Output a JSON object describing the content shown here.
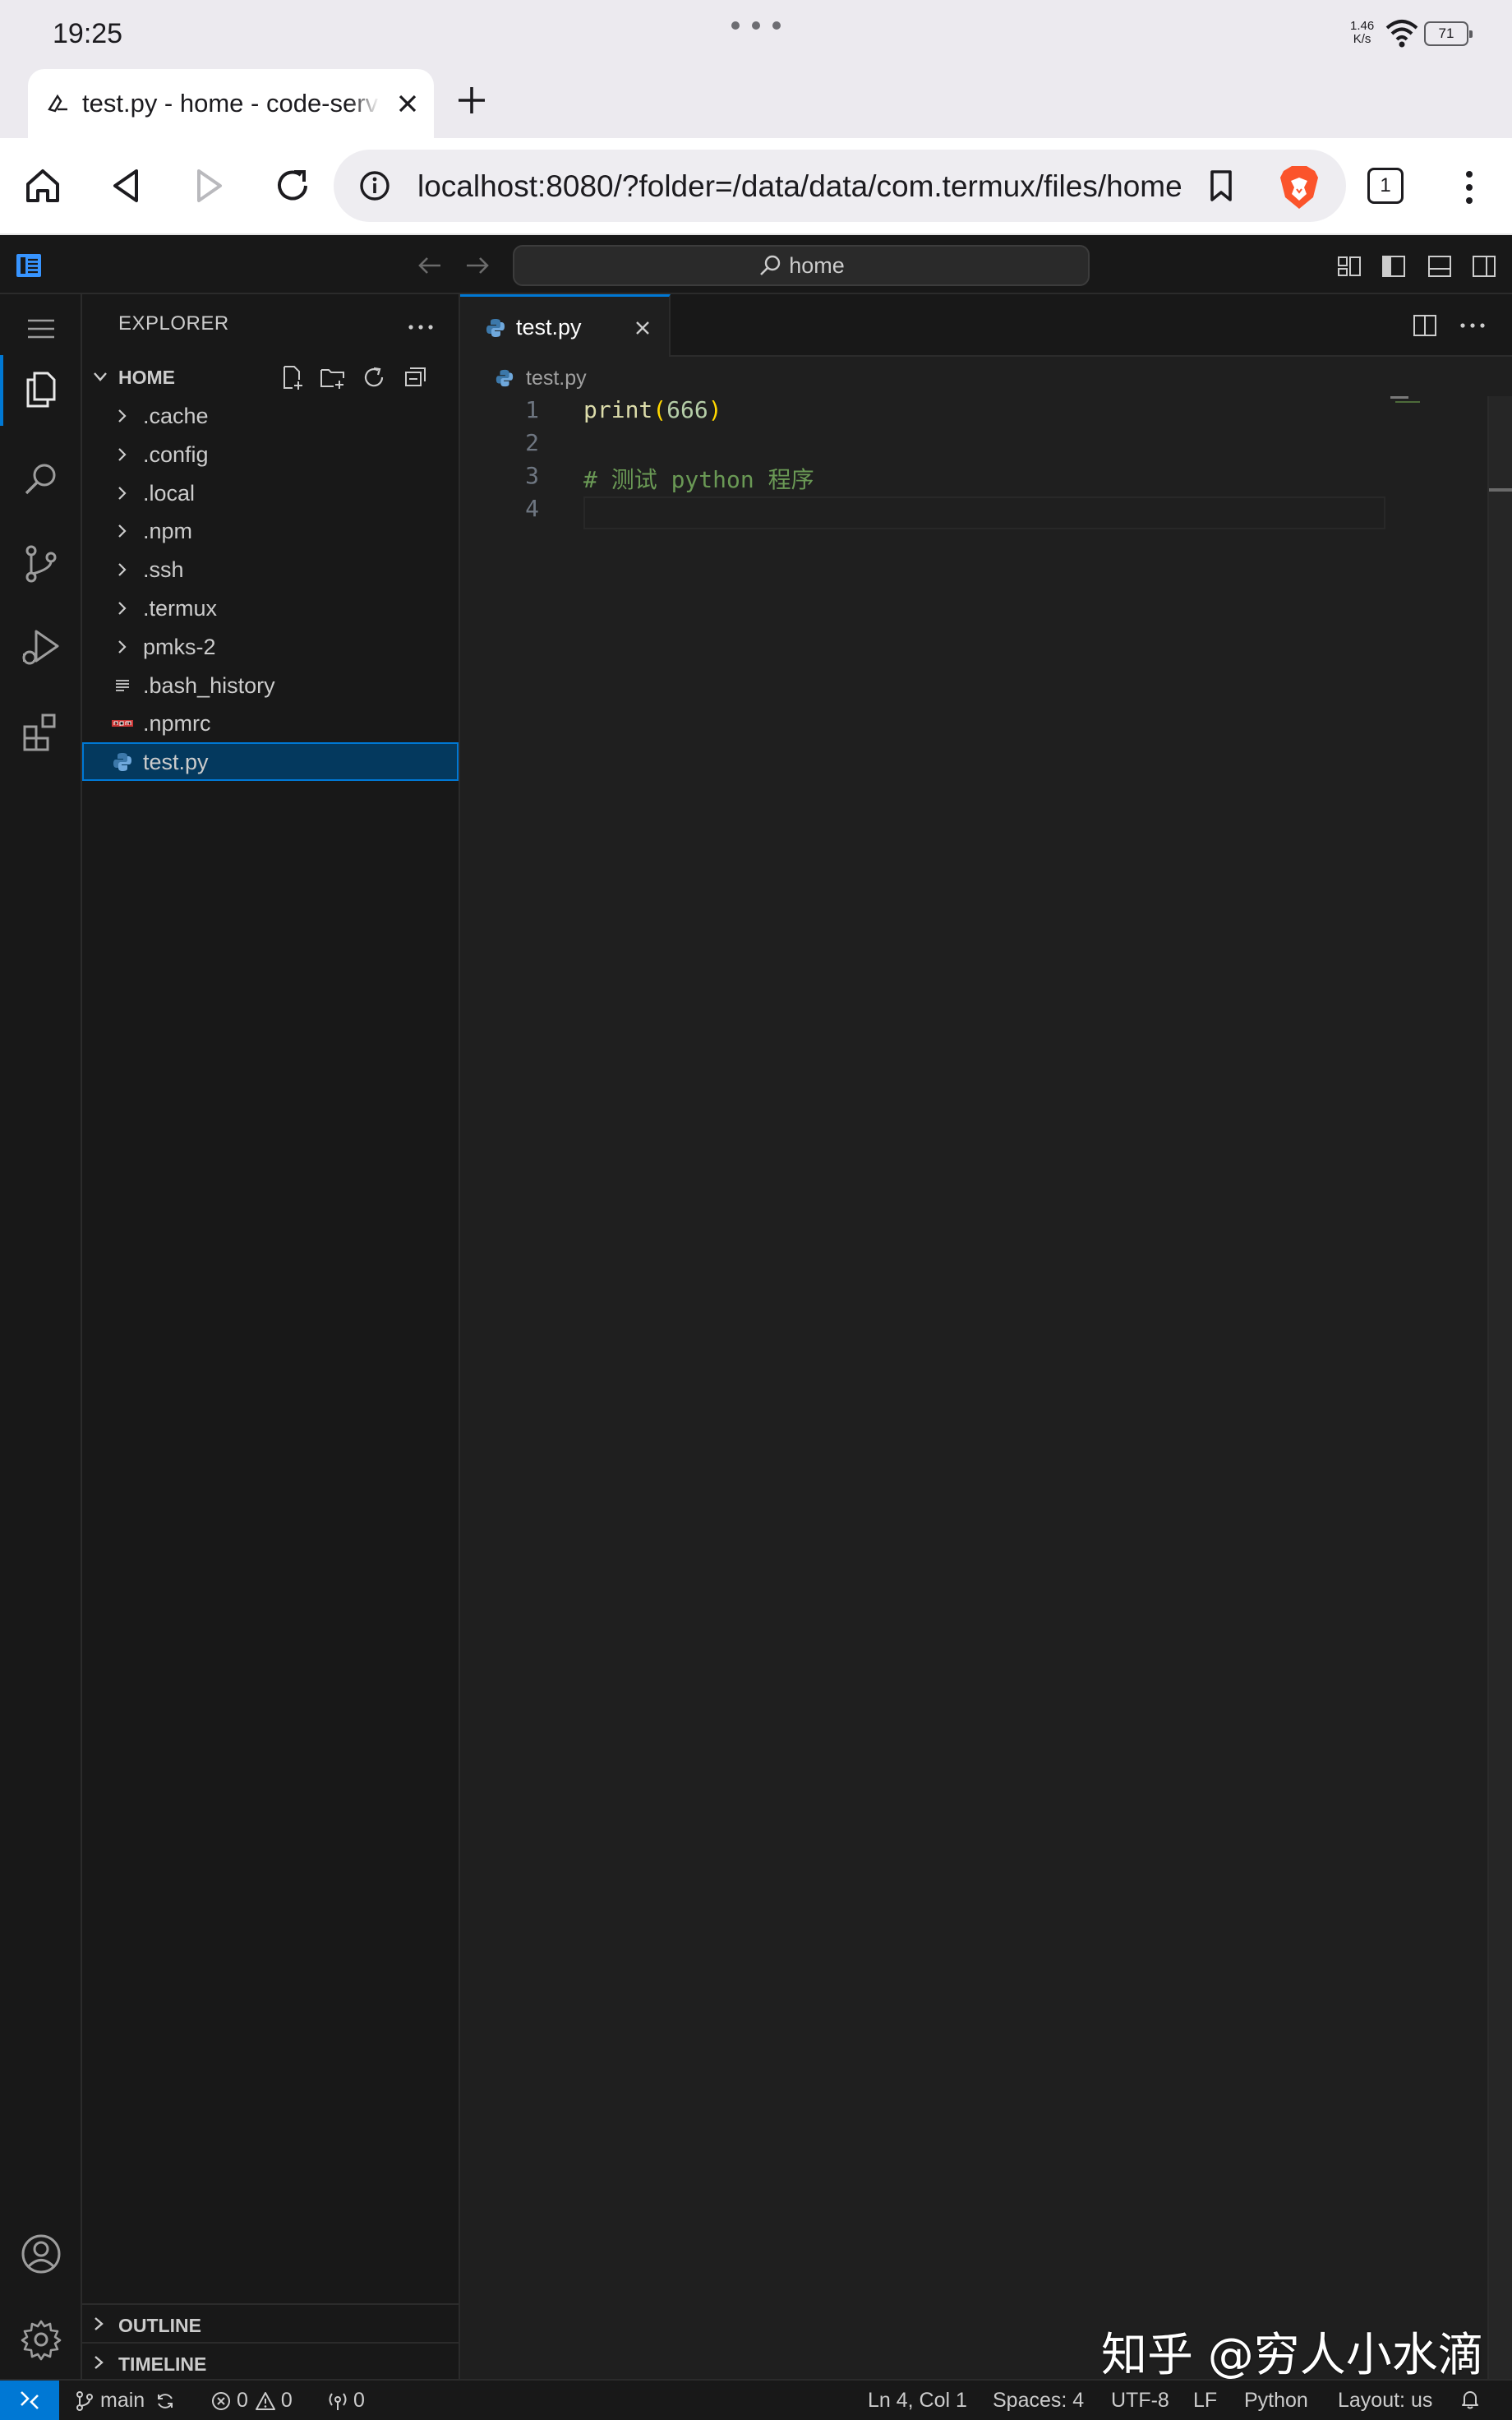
{
  "device": {
    "clock": "19:25",
    "net_speed_value": "1.46",
    "net_speed_unit": "K/s",
    "battery": "71"
  },
  "browser": {
    "tab_title": "test.py - home - code-server",
    "url": "localhost:8080/?folder=/data/data/com.termux/files/home",
    "tab_count": "1"
  },
  "vscode": {
    "command_center": "home",
    "sidebar": {
      "title": "EXPLORER",
      "root": "HOME",
      "items": [
        {
          "label": ".cache",
          "kind": "folder"
        },
        {
          "label": ".config",
          "kind": "folder"
        },
        {
          "label": ".local",
          "kind": "folder"
        },
        {
          "label": ".npm",
          "kind": "folder"
        },
        {
          "label": ".ssh",
          "kind": "folder"
        },
        {
          "label": ".termux",
          "kind": "folder"
        },
        {
          "label": "pmks-2",
          "kind": "folder"
        },
        {
          "label": ".bash_history",
          "kind": "text-file"
        },
        {
          "label": ".npmrc",
          "kind": "npm-file"
        },
        {
          "label": "test.py",
          "kind": "python-file",
          "selected": true
        }
      ],
      "outline": "OUTLINE",
      "timeline": "TIMELINE"
    },
    "editor": {
      "tab_label": "test.py",
      "breadcrumb": "test.py",
      "line_numbers": [
        "1",
        "2",
        "3",
        "4"
      ],
      "lines": [
        {
          "fn": "print",
          "open": "(",
          "num": "666",
          "close": ")"
        },
        {},
        {
          "comment": "# 测试 python 程序"
        },
        {}
      ]
    },
    "status": {
      "branch": "main",
      "errors": "0",
      "warnings": "0",
      "ports": "0",
      "position": "Ln 4, Col 1",
      "spaces": "Spaces: 4",
      "encoding": "UTF-8",
      "eol": "LF",
      "language": "Python",
      "layout": "Layout: us"
    },
    "colors": {
      "accent": "#0078d4",
      "function": "#dcdcaa",
      "number": "#b5cea8",
      "bracket": "#ffd700",
      "comment": "#6a9955"
    }
  },
  "watermark": "知乎 @穷人小水滴"
}
